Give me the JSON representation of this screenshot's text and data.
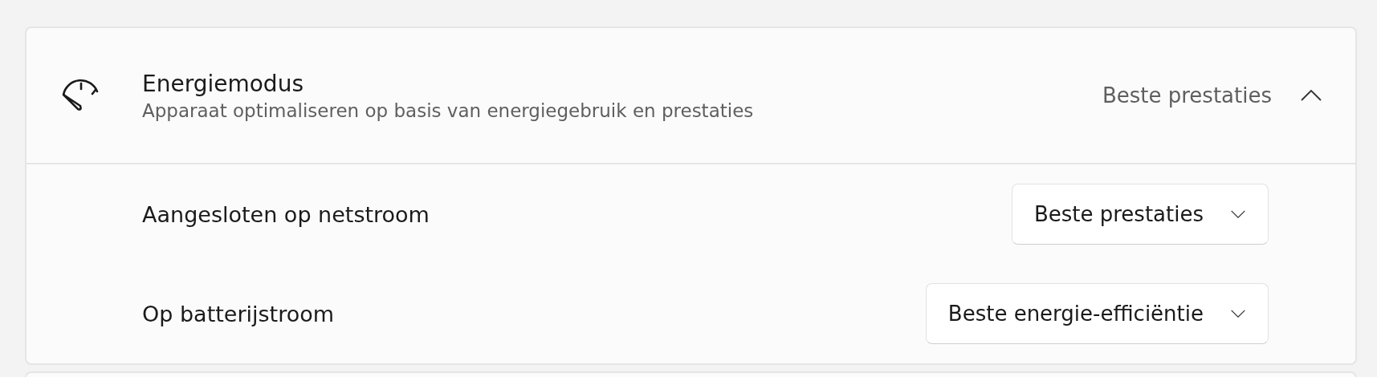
{
  "expander": {
    "title": "Energiemodus",
    "description": "Apparaat optimaliseren op basis van energiegebruik en prestaties",
    "value": "Beste prestaties",
    "expanded": true,
    "rows": [
      {
        "label": "Aangesloten op netstroom",
        "selection": "Beste prestaties"
      },
      {
        "label": "Op batterijstroom",
        "selection": "Beste energie-efficiëntie"
      }
    ]
  }
}
